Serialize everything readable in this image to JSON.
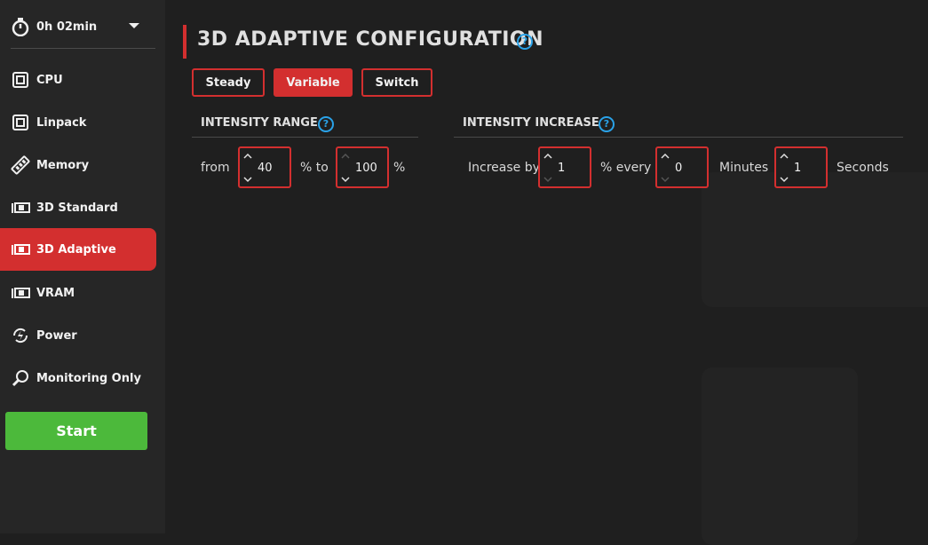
{
  "sidebar": {
    "timer": {
      "value": "0h 02min",
      "icon": "stopwatch-icon"
    },
    "items": [
      {
        "label": "CPU",
        "icon": "cpu-icon",
        "active": false
      },
      {
        "label": "Linpack",
        "icon": "cpu-icon",
        "active": false
      },
      {
        "label": "Memory",
        "icon": "memory-icon",
        "active": false
      },
      {
        "label": "3D Standard",
        "icon": "gpu-icon",
        "active": false
      },
      {
        "label": "3D Adaptive",
        "icon": "gpu-icon",
        "active": true
      },
      {
        "label": "VRAM",
        "icon": "gpu-icon",
        "active": false
      },
      {
        "label": "Power",
        "icon": "power-icon",
        "active": false
      },
      {
        "label": "Monitoring Only",
        "icon": "magnifier-icon",
        "active": false
      }
    ],
    "start_label": "Start"
  },
  "main": {
    "title": "3D ADAPTIVE CONFIGURATION",
    "modes": [
      {
        "label": "Steady",
        "active": false
      },
      {
        "label": "Variable",
        "active": true
      },
      {
        "label": "Switch",
        "active": false
      }
    ],
    "intensity_range": {
      "title": "INTENSITY RANGE",
      "from_label": "from",
      "from_value": "40",
      "to_label": "% to",
      "to_value": "100",
      "suffix": "%"
    },
    "intensity_increase": {
      "title": "INTENSITY INCREASE",
      "by_label": "Increase by",
      "by_value": "1",
      "every_label": "% every",
      "minutes_value": "0",
      "minutes_label": "Minutes",
      "seconds_value": "1",
      "seconds_label": "Seconds"
    }
  },
  "colors": {
    "accent": "#d32f2f",
    "start": "#4cb93b",
    "help": "#2aa2e8",
    "background": "#1f1f1f",
    "sidebar": "#262626"
  }
}
